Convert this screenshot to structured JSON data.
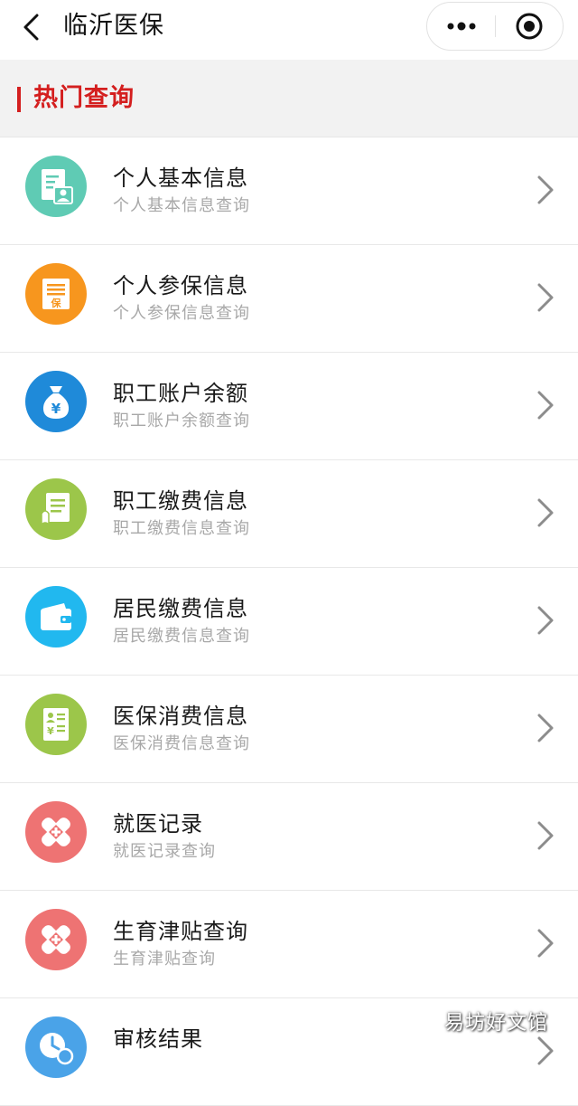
{
  "navbar": {
    "title": "临沂医保",
    "back_icon": "chevron-left-icon",
    "more_icon": "more-dots-icon",
    "close_icon": "target-circle-icon"
  },
  "section": {
    "title": "热门查询",
    "accent_color": "#d41f1f"
  },
  "items": [
    {
      "title": "个人基本信息",
      "subtitle": "个人基本信息查询",
      "icon": "person-card-icon",
      "icon_color": "#5fcbb4"
    },
    {
      "title": "个人参保信息",
      "subtitle": "个人参保信息查询",
      "icon": "insurance-document-icon",
      "icon_color": "#f7961e",
      "icon_glyph": "保"
    },
    {
      "title": "职工账户余额",
      "subtitle": "职工账户余额查询",
      "icon": "money-bag-icon",
      "icon_color": "#1f8ad9",
      "icon_glyph": "¥"
    },
    {
      "title": "职工缴费信息",
      "subtitle": "职工缴费信息查询",
      "icon": "payment-document-icon",
      "icon_color": "#9cc64a"
    },
    {
      "title": "居民缴费信息",
      "subtitle": "居民缴费信息查询",
      "icon": "wallet-icon",
      "icon_color": "#21b8ef"
    },
    {
      "title": "医保消费信息",
      "subtitle": "医保消费信息查询",
      "icon": "medical-receipt-icon",
      "icon_color": "#9cc64a",
      "icon_glyph": "¥"
    },
    {
      "title": "就医记录",
      "subtitle": "就医记录查询",
      "icon": "medical-cross-icon",
      "icon_color": "#ee7373"
    },
    {
      "title": "生育津贴查询",
      "subtitle": "生育津贴查询",
      "icon": "medical-cross-icon",
      "icon_color": "#ee7373"
    },
    {
      "title": "审核结果",
      "subtitle": "",
      "icon": "clock-icon",
      "icon_color": "#4aa3e8"
    }
  ],
  "watermark": "易坊好文馆"
}
